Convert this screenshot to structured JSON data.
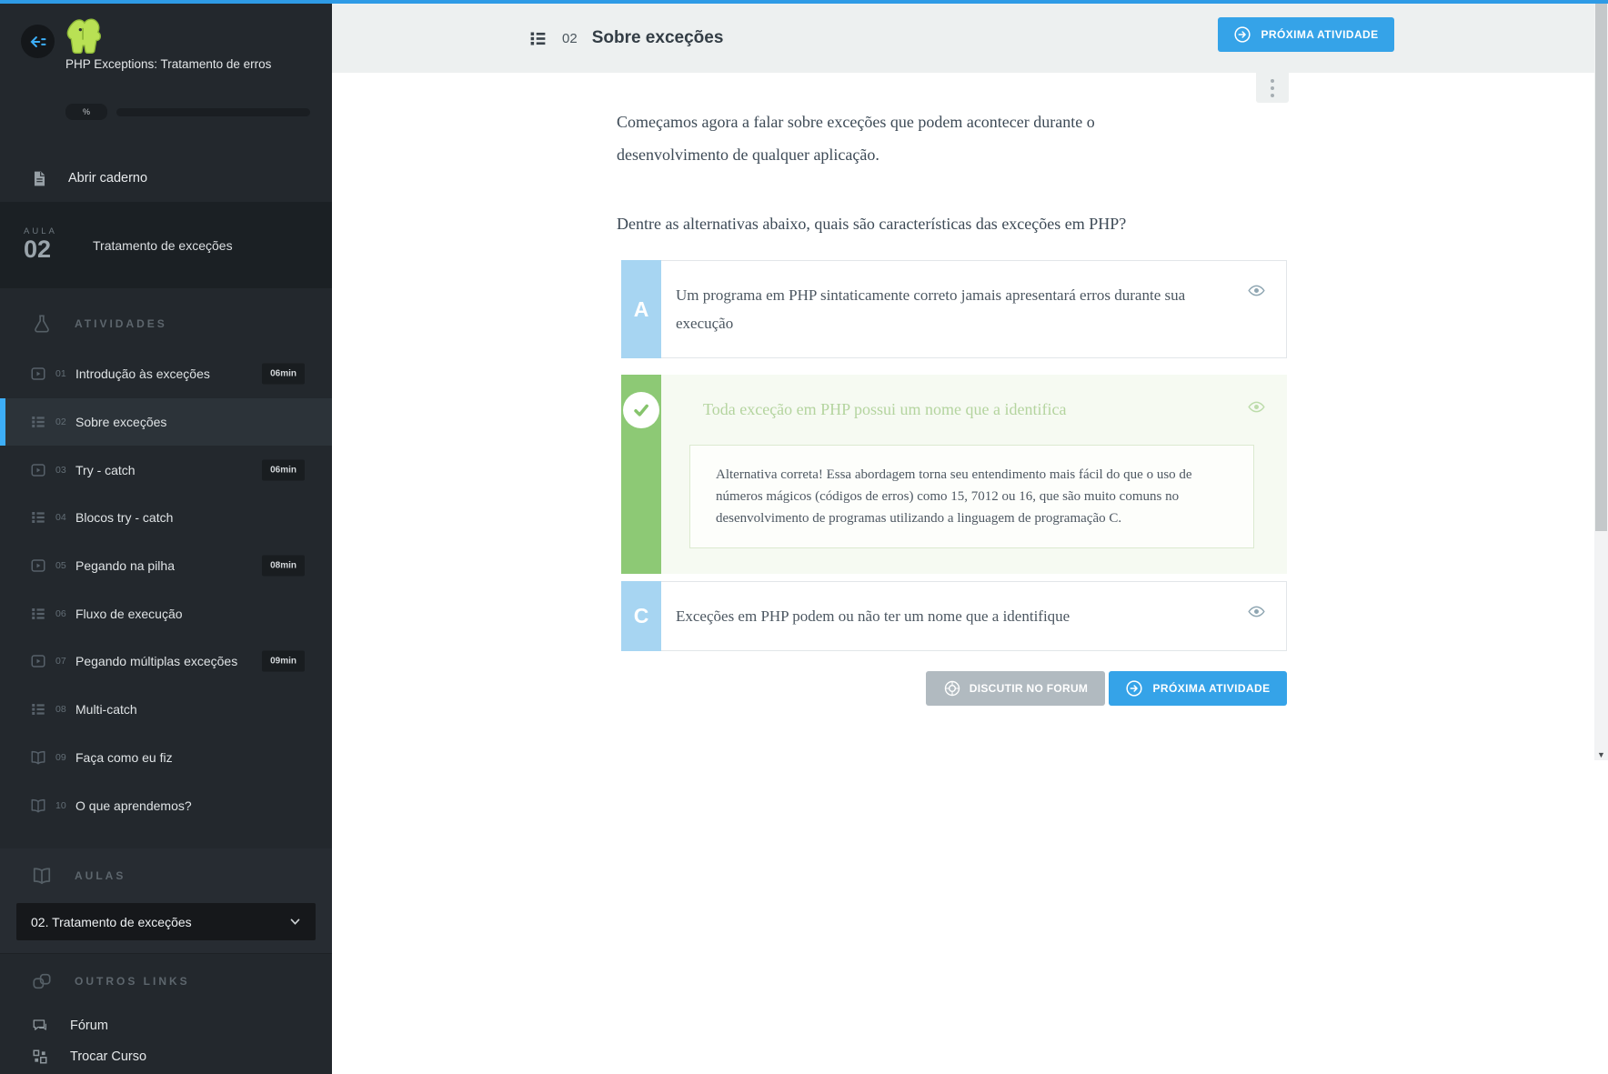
{
  "colors": {
    "topbar_blue": "#2e9be6",
    "accent_blue": "#35a3e8",
    "active_item_blue": "#3daef7",
    "correct_green": "#8dc975",
    "sidebar_bg": "#23282d"
  },
  "sidebar": {
    "course_title": "PHP Exceptions: Tratamento de erros",
    "progress_percent_label": "%",
    "open_notebook": "Abrir caderno",
    "lesson_badge": {
      "label": "AULA",
      "number": "02",
      "title": "Tratamento de exceções"
    },
    "activities_header": "ATIVIDADES",
    "activities": [
      {
        "num": "01",
        "label": "Introdução às exceções",
        "icon": "video-icon",
        "duration": "06min",
        "active": false
      },
      {
        "num": "02",
        "label": "Sobre exceções",
        "icon": "list-icon",
        "duration": "",
        "active": true
      },
      {
        "num": "03",
        "label": "Try - catch",
        "icon": "video-icon",
        "duration": "06min",
        "active": false
      },
      {
        "num": "04",
        "label": "Blocos try - catch",
        "icon": "list-icon",
        "duration": "",
        "active": false
      },
      {
        "num": "05",
        "label": "Pegando na pilha",
        "icon": "video-icon",
        "duration": "08min",
        "active": false
      },
      {
        "num": "06",
        "label": "Fluxo de execução",
        "icon": "list-icon",
        "duration": "",
        "active": false
      },
      {
        "num": "07",
        "label": "Pegando múltiplas exceções",
        "icon": "video-icon",
        "duration": "09min",
        "active": false
      },
      {
        "num": "08",
        "label": "Multi-catch",
        "icon": "list-icon",
        "duration": "",
        "active": false
      },
      {
        "num": "09",
        "label": "Faça como eu fiz",
        "icon": "book-icon",
        "duration": "",
        "active": false
      },
      {
        "num": "10",
        "label": "O que aprendemos?",
        "icon": "book-icon",
        "duration": "",
        "active": false
      }
    ],
    "aulas_header": "AULAS",
    "aulas_selected": "02. Tratamento de exceções",
    "other_links_header": "OUTROS LINKS",
    "forum": "Fórum",
    "change_course": "Trocar Curso"
  },
  "header": {
    "number": "02",
    "title": "Sobre exceções",
    "next_activity": "PRÓXIMA ATIVIDADE"
  },
  "question": {
    "paragraphs": [
      "Começamos agora a falar sobre exceções que podem acontecer durante o desenvolvimento de qualquer aplicação.",
      "Dentre as alternativas abaixo, quais são características das exceções em PHP?"
    ]
  },
  "alternatives": [
    {
      "letter": "A",
      "state": "default",
      "text": "Um programa em PHP sintaticamente correto jamais apresentará erros durante sua execução"
    },
    {
      "letter": "",
      "state": "correct",
      "text": "Toda exceção em PHP possui um nome que a identifica",
      "explanation": "Alternativa correta! Essa abordagem torna seu entendimento mais fácil do que o uso de números mágicos (códigos de erros) como 15, 7012 ou 16, que são muito comuns no desenvolvimento de programas utilizando a linguagem de programação C."
    },
    {
      "letter": "C",
      "state": "default",
      "text": "Exceções em PHP podem ou não ter um nome que a identifique"
    }
  ],
  "actions": {
    "discuss": "DISCUTIR NO FORUM",
    "next": "PRÓXIMA ATIVIDADE"
  }
}
